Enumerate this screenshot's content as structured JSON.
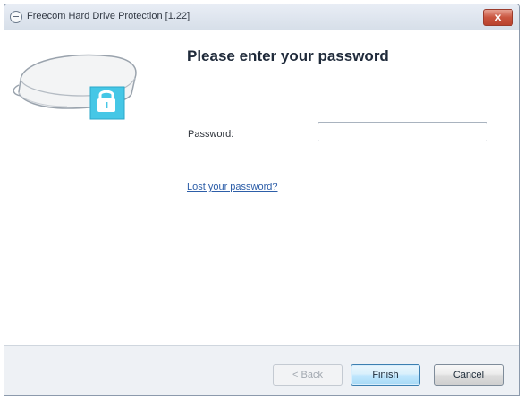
{
  "window": {
    "title": "Freecom Hard Drive Protection [1.22]",
    "close_symbol": "x"
  },
  "icons": {
    "app": "app-icon",
    "close": "close-icon",
    "drive": "hard-drive-lock-icon"
  },
  "main": {
    "heading": "Please enter your password",
    "password_label": "Password:",
    "password_value": "",
    "lost_password_link": "Lost your password?"
  },
  "buttons": {
    "back": "< Back",
    "finish": "Finish",
    "cancel": "Cancel"
  },
  "colors": {
    "lock_badge": "#45c7e6",
    "link": "#2d5ea8",
    "close_button": "#c9553f"
  }
}
